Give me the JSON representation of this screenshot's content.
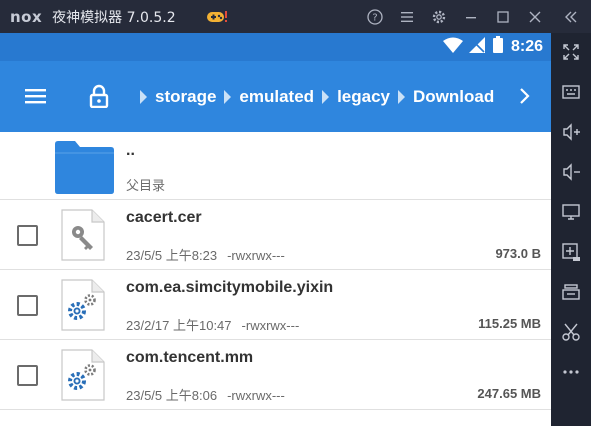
{
  "window": {
    "logo": "nox",
    "title": "夜神模拟器 7.0.5.2",
    "buttons": [
      "help-icon",
      "menu-icon",
      "settings-icon",
      "minimize-icon",
      "maximize-icon",
      "close-icon",
      "collapse-icon"
    ]
  },
  "status_bar": {
    "time": "8:26"
  },
  "breadcrumbs": [
    "storage",
    "emulated",
    "legacy",
    "Download"
  ],
  "parent": {
    "name": "..",
    "label": "父目录"
  },
  "files": [
    {
      "name": "cacert.cer",
      "date": "23/5/5 上午8:23",
      "perm": "-rwxrwx---",
      "size": "973.0 B",
      "icon": "key-file-icon"
    },
    {
      "name": "com.ea.simcitymobile.yixin",
      "date": "23/2/17 上午10:47",
      "perm": "-rwxrwx---",
      "size": "115.25 MB",
      "icon": "gear-file-icon"
    },
    {
      "name": "com.tencent.mm",
      "date": "23/5/5 上午8:06",
      "perm": "-rwxrwx---",
      "size": "247.65 MB",
      "icon": "gear-file-icon"
    }
  ],
  "side_toolbar": [
    "fullscreen-icon",
    "keyboard-icon",
    "volume-up-icon",
    "volume-down-icon",
    "screen-icon",
    "apk-install-icon",
    "multi-instance-icon",
    "cut-icon",
    "more-icon"
  ],
  "colors": {
    "status_bar": "#2879d0",
    "app_bar": "#2f86de",
    "folder": "#2f86de",
    "chrome": "#262b3a"
  }
}
